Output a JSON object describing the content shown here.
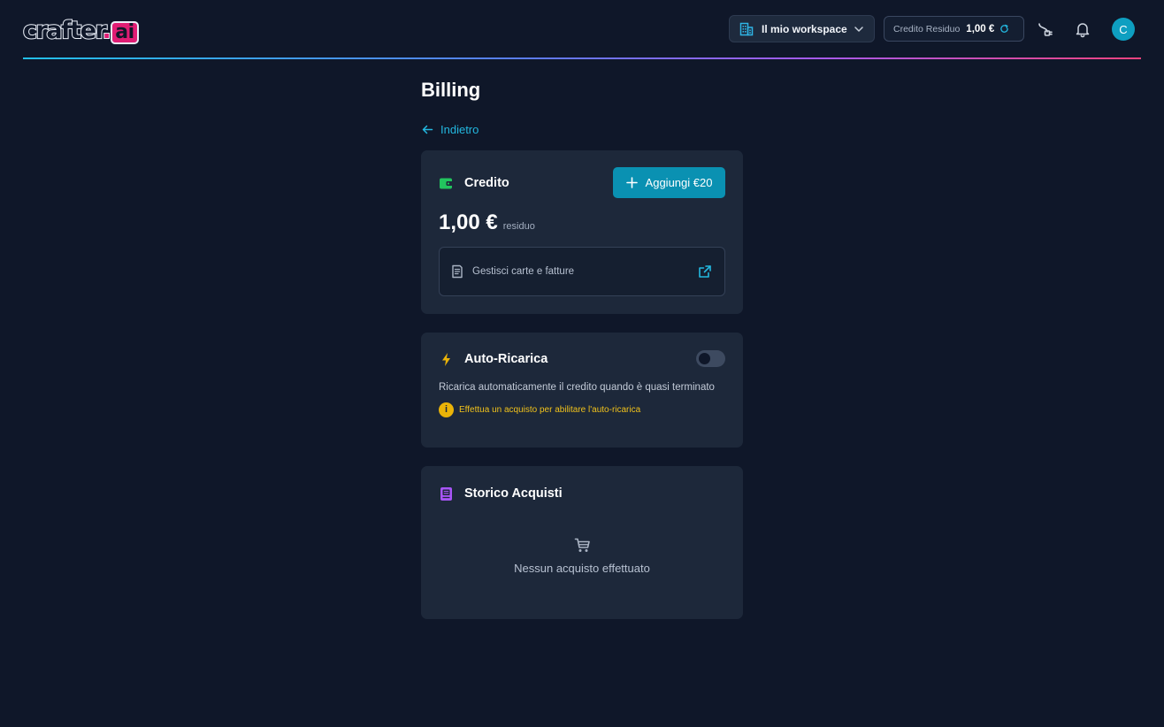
{
  "header": {
    "logo": {
      "main": "crafter",
      "dot": ".",
      "suffix": "ai"
    },
    "workspace": {
      "label": "Il mio workspace"
    },
    "credit": {
      "label": "Credito Residuo",
      "value": "1,00 €"
    },
    "avatar_initial": "C"
  },
  "page": {
    "title": "Billing",
    "back_label": "Indietro"
  },
  "credito": {
    "title": "Credito",
    "add_button_label": "Aggiungi €20",
    "amount": "1,00 €",
    "amount_suffix": "residuo",
    "manage_label": "Gestisci carte e fatture"
  },
  "auto_ricarica": {
    "title": "Auto-Ricarica",
    "enabled": false,
    "description": "Ricarica automaticamente il credito quando è quasi terminato",
    "warning": "Effettua un acquisto per abilitare l'auto-ricarica"
  },
  "storico": {
    "title": "Storico Acquisti",
    "empty_text": "Nessun acquisto effettuato"
  },
  "colors": {
    "background": "#0f1729",
    "card": "#1d283a",
    "accent": "#0a91b2",
    "link": "#23b8e0",
    "success": "#22c55e",
    "warning": "#eab308",
    "purple": "#a855f7"
  },
  "icons": {
    "workspace": "building-icon",
    "credit_refresh": "refresh-icon",
    "plug": "plug-icon",
    "bell": "bell-icon",
    "back": "arrow-left-icon",
    "wallet": "wallet-icon",
    "plus": "plus-icon",
    "receipt": "receipt-icon",
    "external": "external-link-icon",
    "bolt": "bolt-icon",
    "info": "info-icon",
    "history": "document-icon",
    "cart": "cart-icon"
  }
}
